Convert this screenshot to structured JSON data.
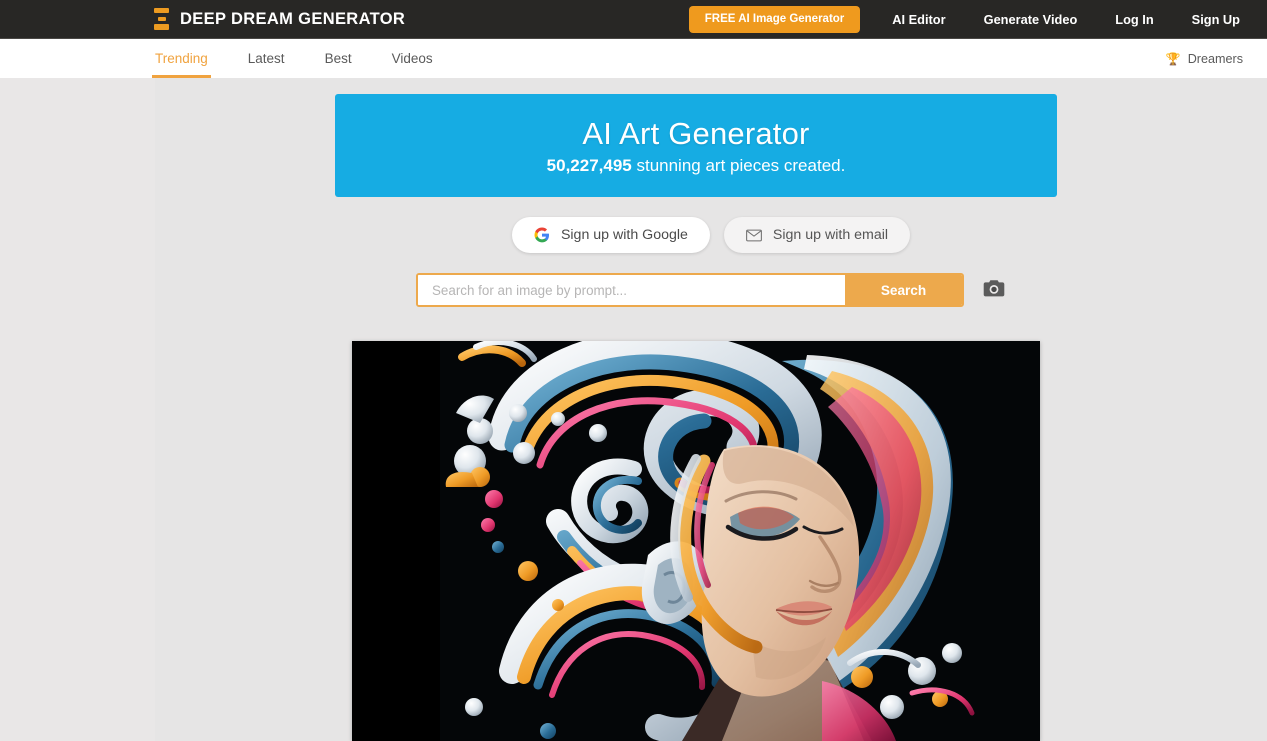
{
  "header": {
    "logo_icon": "hourglass-logo-icon",
    "brand": "DEEP DREAM GENERATOR",
    "cta_label": "FREE AI Image Generator",
    "nav": [
      {
        "label": "AI Editor"
      },
      {
        "label": "Generate Video"
      },
      {
        "label": "Log In"
      },
      {
        "label": "Sign Up"
      }
    ]
  },
  "subnav": {
    "tabs": [
      {
        "label": "Trending",
        "active": true
      },
      {
        "label": "Latest",
        "active": false
      },
      {
        "label": "Best",
        "active": false
      },
      {
        "label": "Videos",
        "active": false
      }
    ],
    "dreamers_label": "Dreamers",
    "dreamers_icon": "trophy-icon"
  },
  "hero": {
    "title": "AI Art Generator",
    "count": "50,227,495",
    "subtitle_rest": " stunning art pieces created."
  },
  "signup": {
    "google_label": "Sign up with Google",
    "google_icon": "google-g-icon",
    "email_label": "Sign up with email",
    "email_icon": "envelope-icon"
  },
  "search": {
    "placeholder": "Search for an image by prompt...",
    "value": "",
    "button_label": "Search",
    "camera_icon": "camera-icon"
  },
  "artwork": {
    "alt": "Surreal portrait of a woman with flowing swirling multicolored liquid hair on a black background",
    "background": "#000000",
    "palette": [
      "#f0f3f6",
      "#2a6c96",
      "#ef9b26",
      "#e0356e",
      "#d9e4ec",
      "#1f5f85"
    ]
  },
  "colors": {
    "header_bg": "#282725",
    "accent_orange": "#ef9a1e",
    "tab_active": "#f0a33f",
    "hero_blue": "#16ace3",
    "page_bg": "#e9e7e7",
    "content_bg": "#e6e5e5",
    "search_border": "#eda94c"
  }
}
